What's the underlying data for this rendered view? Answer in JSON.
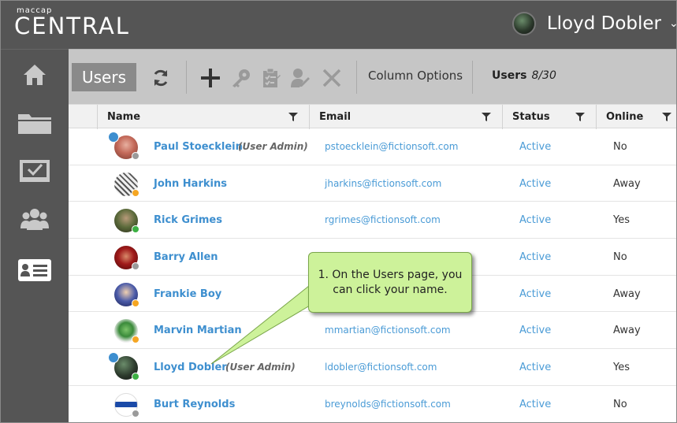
{
  "header": {
    "logo_small": "maccap",
    "logo_big": "CENTRAL",
    "user_name": "Lloyd Dobler",
    "caret": "⌄"
  },
  "sidebar": {
    "items": [
      {
        "icon": "home-icon"
      },
      {
        "icon": "folder-icon"
      },
      {
        "icon": "checkbox-icon"
      },
      {
        "icon": "group-icon"
      },
      {
        "icon": "id-card-icon",
        "active": true
      }
    ]
  },
  "toolbar": {
    "tab_label": "Users",
    "column_options": "Column Options",
    "users_label": "Users",
    "users_count": "8/30",
    "icons": [
      "refresh-icon",
      "add-icon",
      "key-icon",
      "clipboard-icon",
      "user-edit-icon",
      "delete-icon"
    ]
  },
  "table": {
    "columns": [
      "Name",
      "Email",
      "Status",
      "Online"
    ],
    "rows": [
      {
        "name": "Paul Stoecklein",
        "role": "(User Admin)",
        "email": "pstoecklein@fictionsoft.com",
        "status": "Active",
        "online": "No",
        "admin": true,
        "presence": "#9a9a9a"
      },
      {
        "name": "John Harkins",
        "role": "",
        "email": "jharkins@fictionsoft.com",
        "status": "Active",
        "online": "Away",
        "admin": false,
        "presence": "#f5a623"
      },
      {
        "name": "Rick Grimes",
        "role": "",
        "email": "rgrimes@fictionsoft.com",
        "status": "Active",
        "online": "Yes",
        "admin": false,
        "presence": "#3cb043"
      },
      {
        "name": "Barry Allen",
        "role": "",
        "email": "",
        "status": "Active",
        "online": "No",
        "admin": false,
        "presence": "#9a9a9a"
      },
      {
        "name": "Frankie Boy",
        "role": "",
        "email": "",
        "status": "Active",
        "online": "Away",
        "admin": false,
        "presence": "#f5a623"
      },
      {
        "name": "Marvin Martian",
        "role": "",
        "email": "mmartian@fictionsoft.com",
        "status": "Active",
        "online": "Away",
        "admin": false,
        "presence": "#f5a623"
      },
      {
        "name": "Lloyd Dobler",
        "role": "(User Admin)",
        "email": "ldobler@fictionsoft.com",
        "status": "Active",
        "online": "Yes",
        "admin": true,
        "presence": "#3cb043"
      },
      {
        "name": "Burt Reynolds",
        "role": "",
        "email": "breynolds@fictionsoft.com",
        "status": "Active",
        "online": "No",
        "admin": false,
        "presence": "#9a9a9a"
      }
    ]
  },
  "callout": {
    "text": "1. On the Users page, you can click your name."
  },
  "colors": {
    "chrome": "#555555",
    "toolbar": "#c6c6c6",
    "link": "#3e8fcf",
    "callout": "#cdf29a"
  }
}
